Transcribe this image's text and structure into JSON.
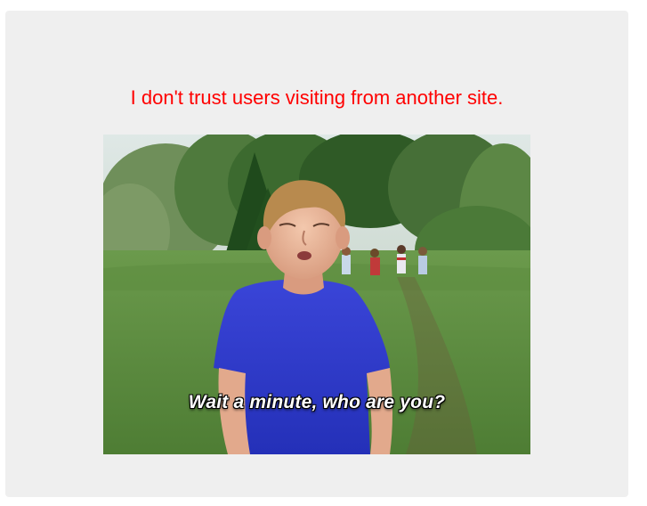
{
  "page": {
    "message": "I don't trust users visiting from another site.",
    "message_color": "#ff0000",
    "card_background": "#efefef"
  },
  "image": {
    "caption": "Wait a minute, who are you?",
    "alt_description": "boy-in-blue-shirt-meme"
  }
}
